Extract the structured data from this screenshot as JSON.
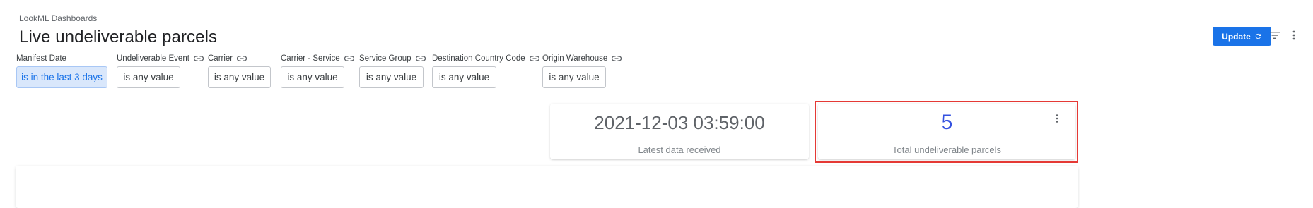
{
  "header": {
    "breadcrumb": "LookML Dashboards",
    "title": "Live undeliverable parcels",
    "update_label": "Update"
  },
  "filters": [
    {
      "label": "Manifest Date",
      "value": "is in the last 3 days",
      "active": true,
      "linked": false
    },
    {
      "label": "Undeliverable Event",
      "value": "is any value",
      "active": false,
      "linked": true
    },
    {
      "label": "Carrier",
      "value": "is any value",
      "active": false,
      "linked": true
    },
    {
      "label": "Carrier - Service",
      "value": "is any value",
      "active": false,
      "linked": true
    },
    {
      "label": "Service Group",
      "value": "is any value",
      "active": false,
      "linked": true
    },
    {
      "label": "Destination Country Code",
      "value": "is any value",
      "active": false,
      "linked": true
    },
    {
      "label": "Origin Warehouse",
      "value": "is any value",
      "active": false,
      "linked": true
    }
  ],
  "tiles": [
    {
      "value": "2021-12-03 03:59:00",
      "label": "Latest data received"
    },
    {
      "value": "5",
      "label": "Total undeliverable parcels"
    }
  ],
  "colors": {
    "accent": "#1a73e8",
    "active_chip_bg": "#d9e7fb",
    "metric_value": "#3451e0",
    "highlight": "#e53935"
  },
  "icons": {
    "update": "refresh-icon",
    "filter": "filter-icon",
    "menu": "kebab-menu-icon",
    "link": "link-icon"
  }
}
